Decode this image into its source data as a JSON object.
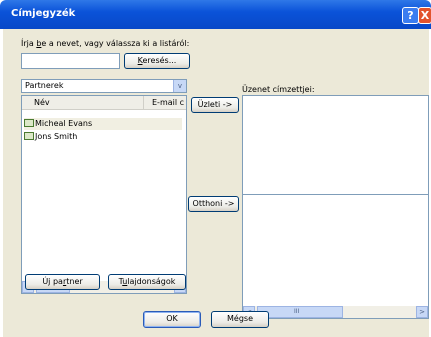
{
  "window": {
    "title": "Címjegyzék"
  },
  "instruction": {
    "pre": "Írja ",
    "underlined": "b",
    "post": "e a nevet, vagy válassza ki a listáról:"
  },
  "search": {
    "value": "",
    "button_underlined": "K",
    "button_rest": "eresés..."
  },
  "addressbook": {
    "selected": "Partnerek"
  },
  "contacts": {
    "col_name": "Név",
    "col_email": "E-mail c",
    "items": [
      "Micheal Evans",
      "Jons Smith"
    ]
  },
  "recipients": {
    "label": "Üzenet címzettjei:",
    "business_button": "Üzleti ->",
    "home_button": "Otthoni ->"
  },
  "buttons": {
    "new_contact_pre": "Új pa",
    "new_contact_u": "r",
    "new_contact_post": "tner",
    "properties_pre": "T",
    "properties_u": "u",
    "properties_post": "lajdonságok",
    "ok": "OK",
    "cancel": "Mégse"
  },
  "scroll": {
    "thumb_glyph": "III",
    "left_glyph": "<",
    "right_glyph": ">"
  },
  "controls": {
    "help_glyph": "?",
    "close_glyph": "X",
    "dropdown_glyph": "v"
  }
}
